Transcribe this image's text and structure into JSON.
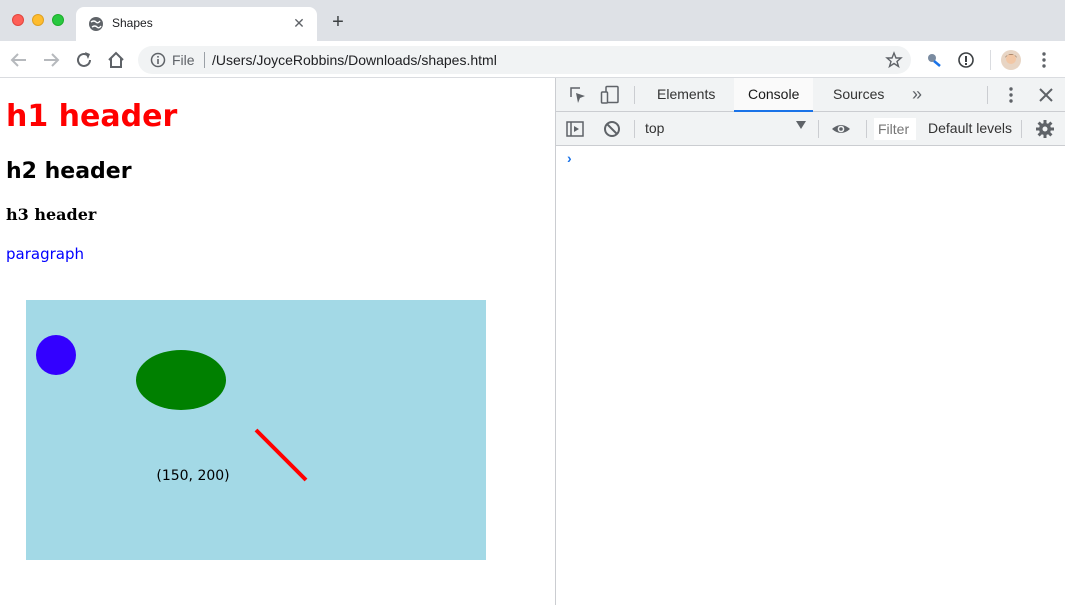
{
  "browser": {
    "tab": {
      "title": "Shapes"
    },
    "address": {
      "scheme_label": "File",
      "url": "/Users/JoyceRobbins/Downloads/shapes.html"
    }
  },
  "page": {
    "h1": "h1 header",
    "h2": "h2 header",
    "h3": "h3 header",
    "paragraph": "paragraph",
    "colors": {
      "h1": "#ff0000",
      "paragraph": "#0000ff"
    },
    "svg": {
      "background": "#a3d9e6",
      "circle_fill": "#3300ff",
      "ellipse_fill": "#008000",
      "line_stroke": "#ff0000",
      "label": "(150, 200)"
    }
  },
  "devtools": {
    "tabs": [
      {
        "label": "Elements",
        "active": false
      },
      {
        "label": "Console",
        "active": true
      },
      {
        "label": "Sources",
        "active": false
      }
    ],
    "context": "top",
    "filter_placeholder": "Filter",
    "levels_label": "Default levels"
  }
}
